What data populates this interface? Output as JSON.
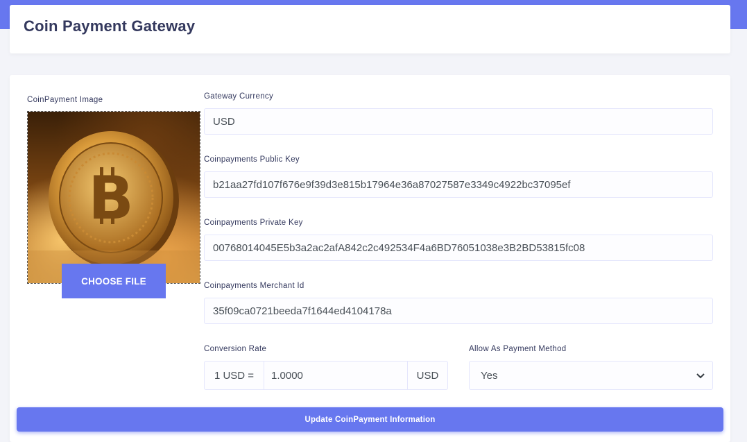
{
  "header": {
    "title": "Coin Payment Gateway"
  },
  "image_section": {
    "label": "CoinPayment Image",
    "choose_button": "CHOOSE FILE"
  },
  "fields": {
    "currency": {
      "label": "Gateway Currency",
      "value": "USD"
    },
    "public_key": {
      "label": "Coinpayments Public Key",
      "value": "b21aa27fd107f676e9f39d3e815b17964e36a87027587e3349c4922bc37095ef"
    },
    "private_key": {
      "label": "Coinpayments Private Key",
      "value": "00768014045E5b3a2ac2afA842c2c492534F4a6BD76051038e3B2BD53815fc08"
    },
    "merchant_id": {
      "label": "Coinpayments Merchant Id",
      "value": "35f09ca0721beeda7f1644ed4104178a"
    },
    "conversion": {
      "label": "Conversion Rate",
      "prefix": "1 USD =",
      "value": "1.0000",
      "suffix": "USD"
    },
    "payment_method": {
      "label": "Allow As Payment Method",
      "selected": "Yes"
    }
  },
  "update_button": "Update CoinPayment Information",
  "colors": {
    "accent": "#6777ef",
    "text": "#34395e",
    "background": "#f3f4f9"
  }
}
